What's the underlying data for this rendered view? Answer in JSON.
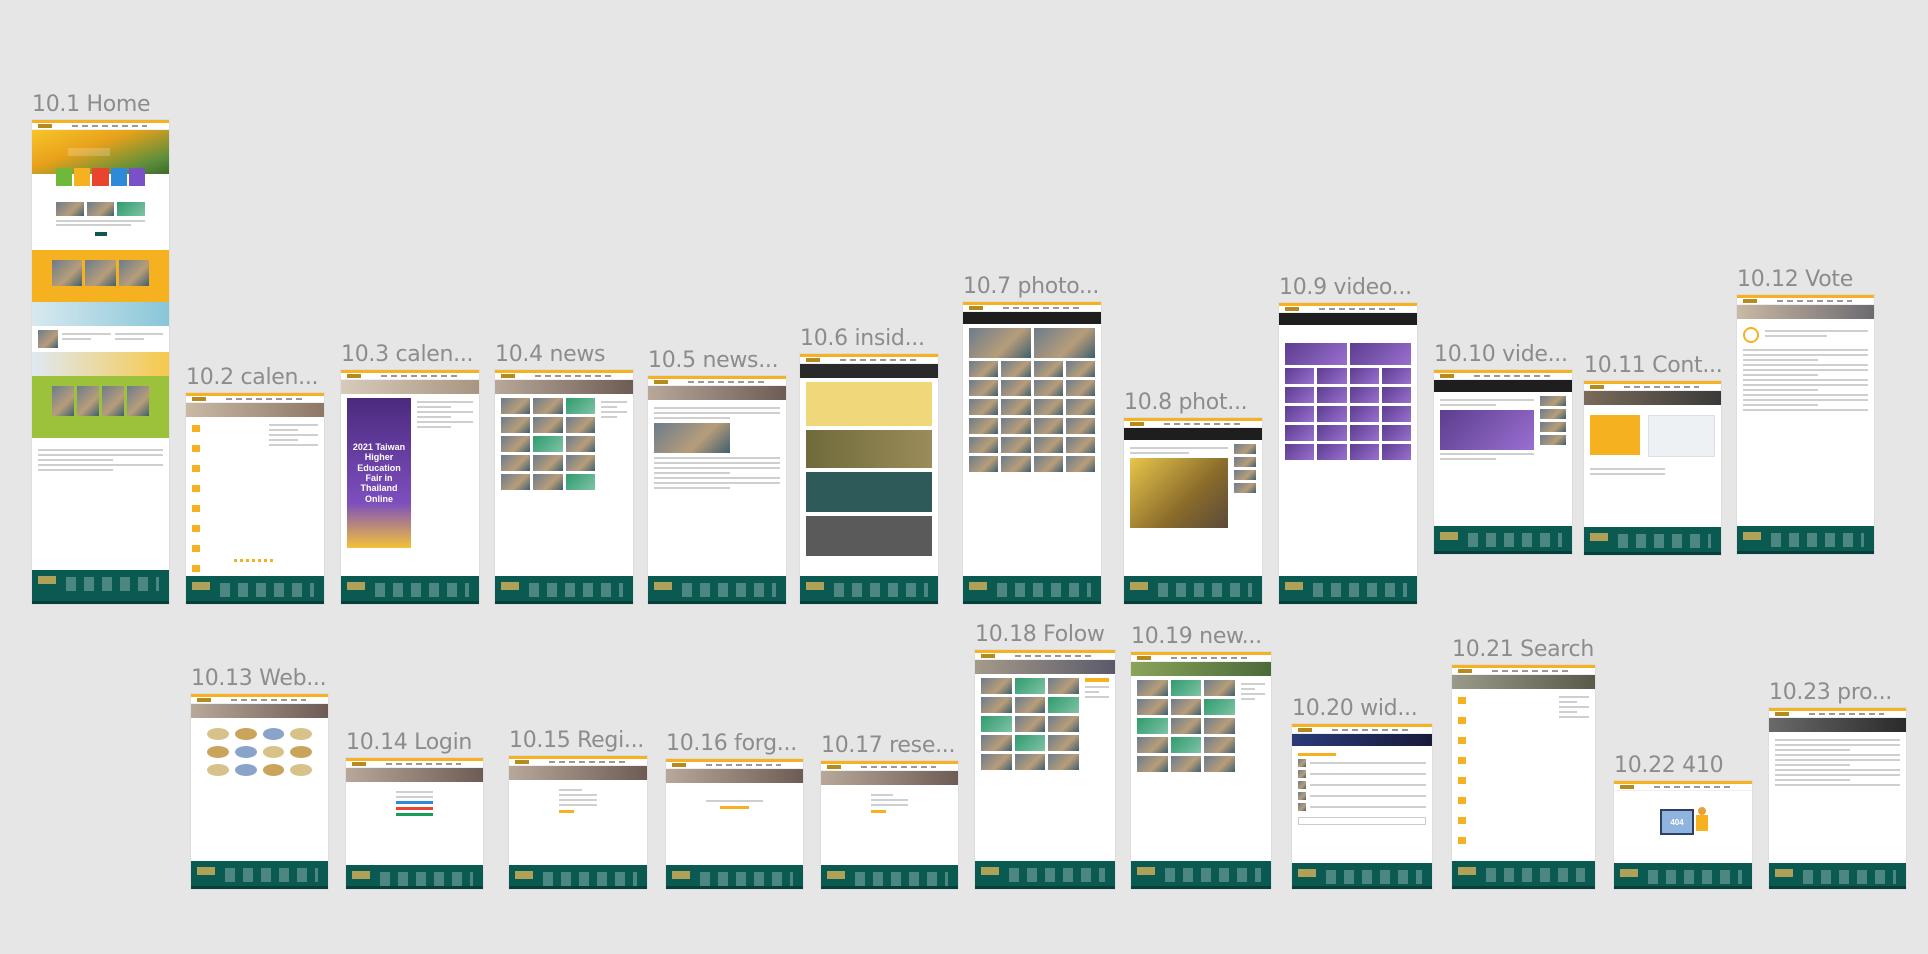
{
  "canvas": {
    "background": "#e6e6e6"
  },
  "colors": {
    "accent": "#f5b120",
    "footer": "#0b5a52",
    "label": "#8c8c8c"
  },
  "frames": [
    {
      "id": "f1",
      "label": "10.1 Home"
    },
    {
      "id": "f2",
      "label": "10.2 calen..."
    },
    {
      "id": "f3",
      "label": "10.3 calen..."
    },
    {
      "id": "f4",
      "label": "10.4 news"
    },
    {
      "id": "f5",
      "label": "10.5 news..."
    },
    {
      "id": "f6",
      "label": "10.6 insid..."
    },
    {
      "id": "f7",
      "label": "10.7 photo..."
    },
    {
      "id": "f8",
      "label": "10.8 phot..."
    },
    {
      "id": "f9",
      "label": "10.9 video..."
    },
    {
      "id": "f10",
      "label": "10.10 vide..."
    },
    {
      "id": "f11",
      "label": "10.11 Cont..."
    },
    {
      "id": "f12",
      "label": "10.12 Vote"
    },
    {
      "id": "f13",
      "label": "10.13 Web..."
    },
    {
      "id": "f14",
      "label": "10.14 Login"
    },
    {
      "id": "f15",
      "label": "10.15 Regi..."
    },
    {
      "id": "f16",
      "label": "10.16 forg..."
    },
    {
      "id": "f17",
      "label": "10.17 rese..."
    },
    {
      "id": "f18",
      "label": "10.18 Folow"
    },
    {
      "id": "f19",
      "label": "10.19 new..."
    },
    {
      "id": "f20",
      "label": "10.20 wid..."
    },
    {
      "id": "f21",
      "label": "10.21 Search"
    },
    {
      "id": "f22",
      "label": "10.22 410"
    },
    {
      "id": "f23",
      "label": "10.23 pro..."
    }
  ],
  "thumb_text": {
    "f3_poster": "2021 Taiwan Higher Education Fair in Thailand Online",
    "f22_code": "404"
  }
}
